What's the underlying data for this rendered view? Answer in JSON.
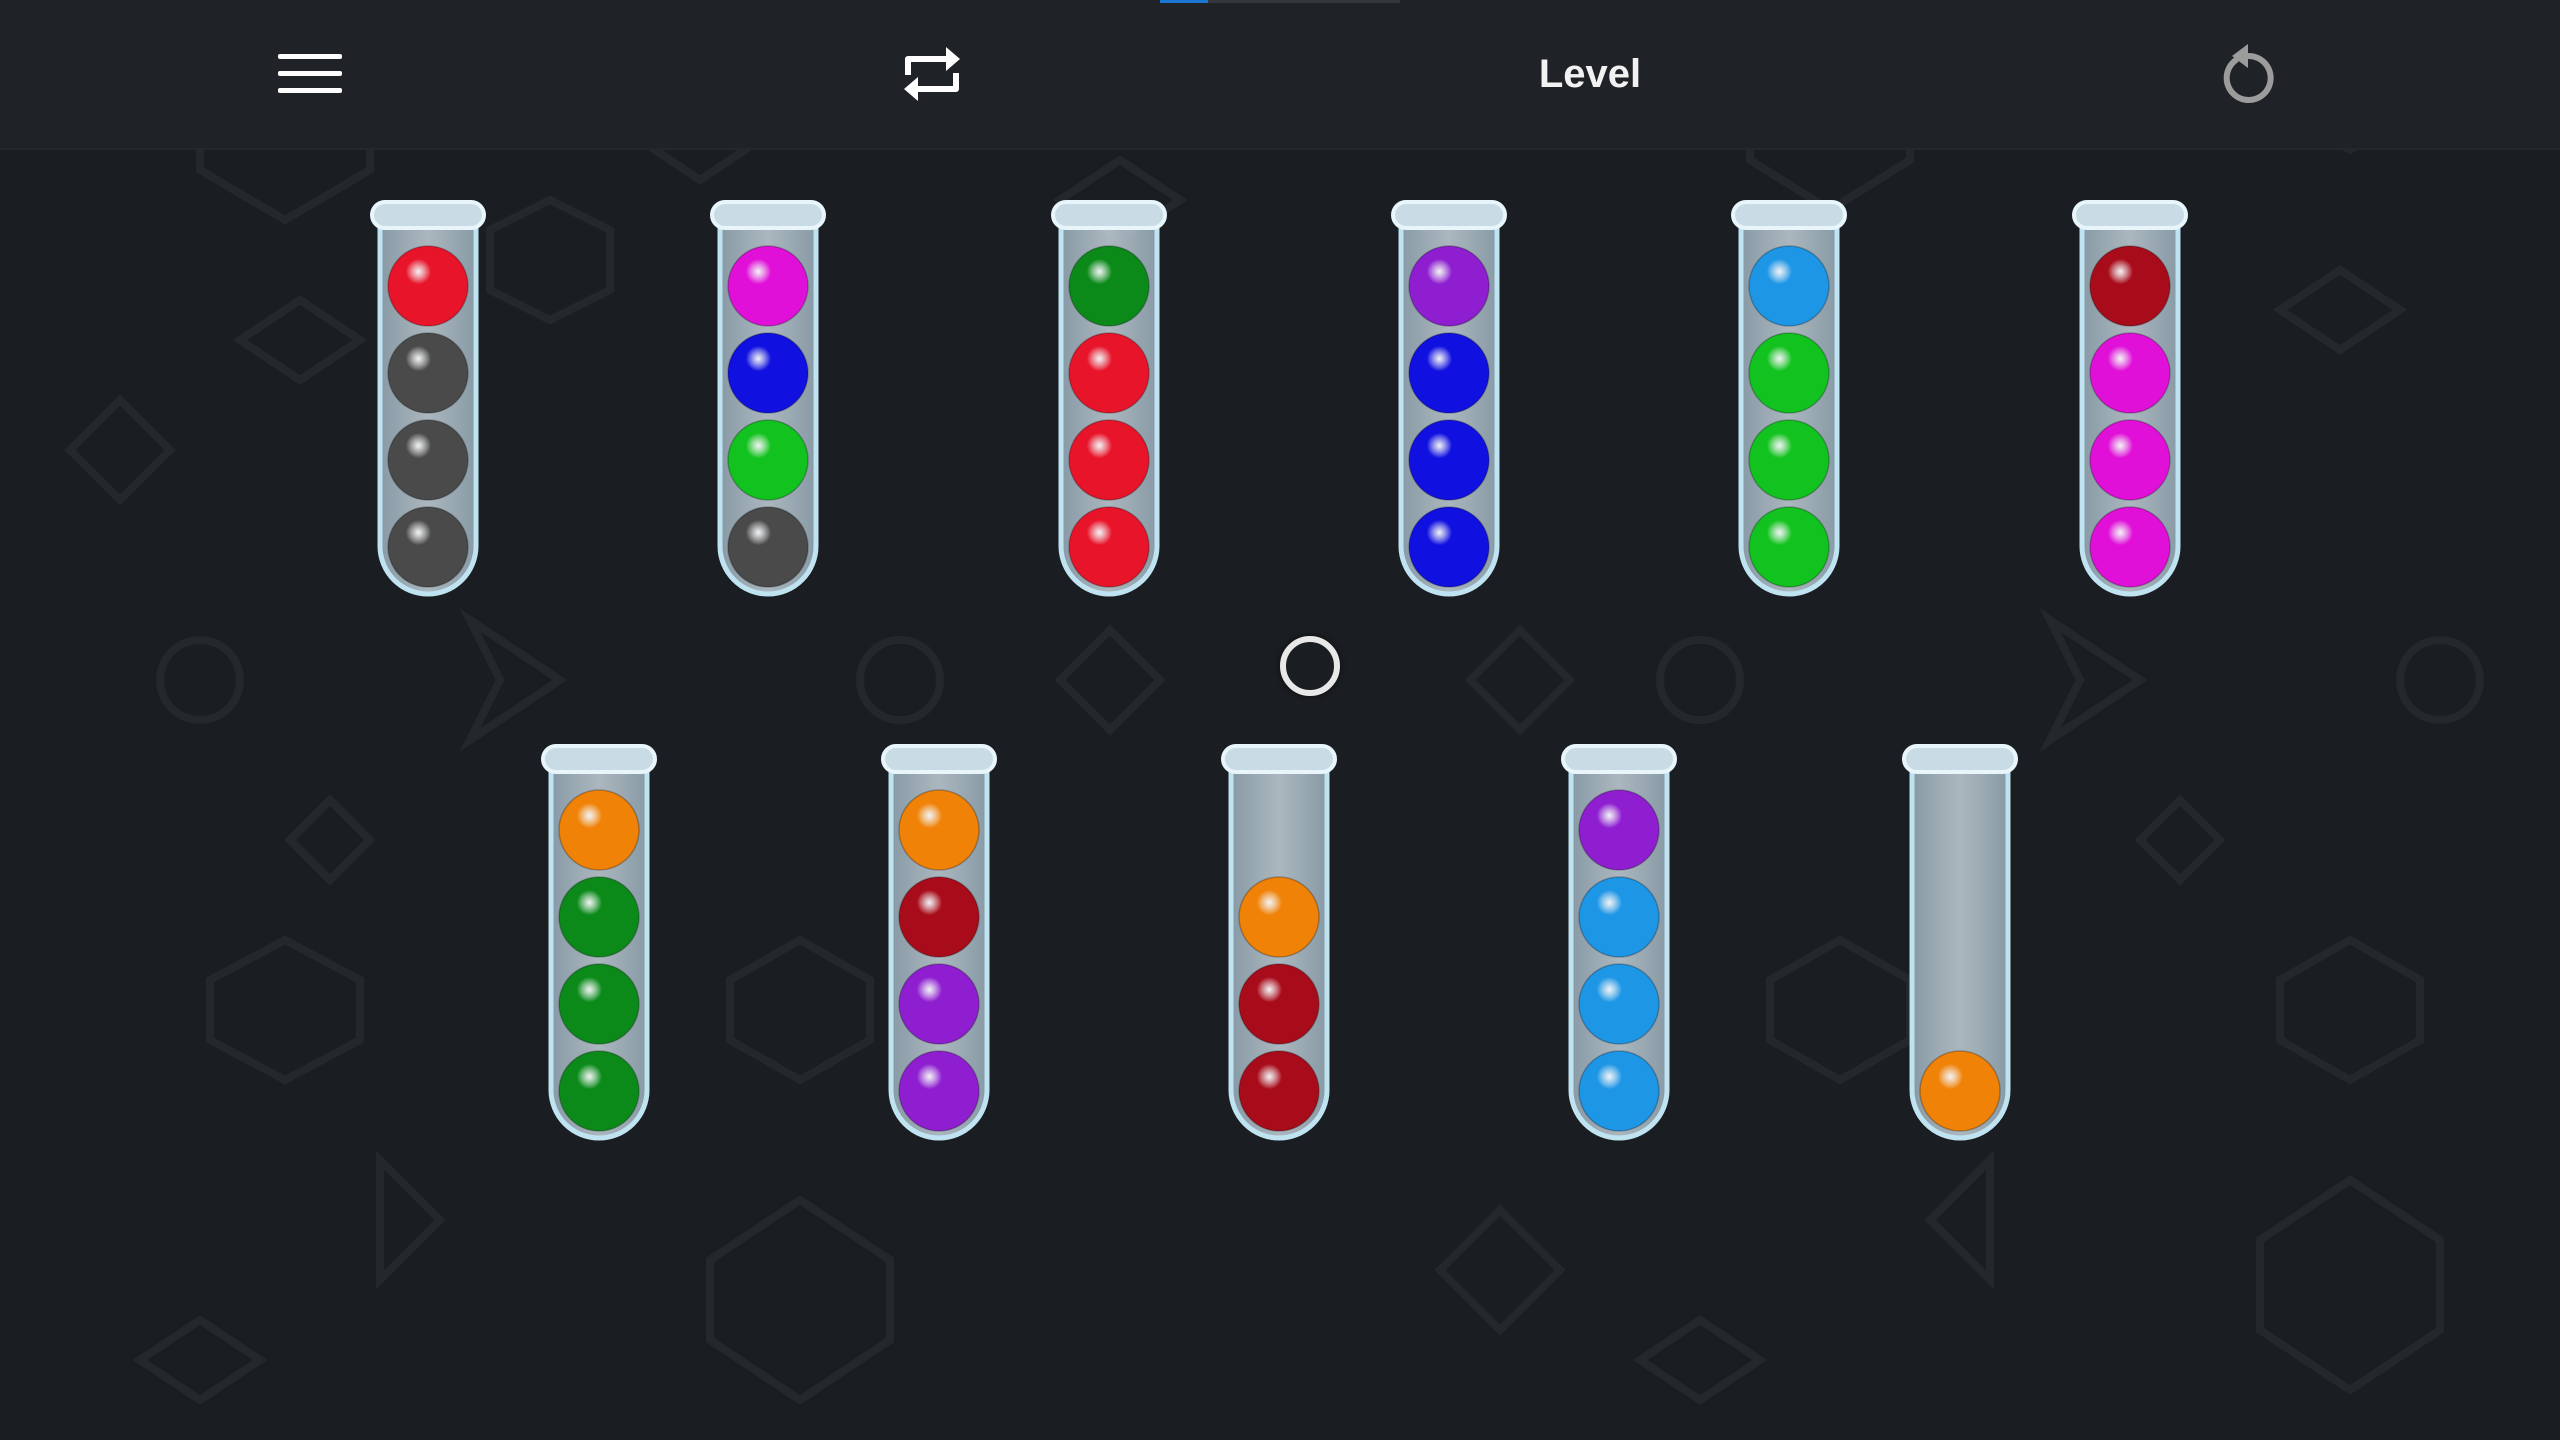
{
  "header": {
    "title": "Level",
    "menu_icon": "hamburger-menu-icon",
    "shuffle_icon": "shuffle-arrows-icon",
    "restart_icon": "restart-icon",
    "progress_fraction": 0.2,
    "progress_color": "#1976d2"
  },
  "colors": {
    "red": "#e8142a",
    "gray": "#4a4a4a",
    "magenta": "#e010d8",
    "blue": "#1010e0",
    "green": "#12c21e",
    "darkgreen": "#0b8a1a",
    "purple": "#8e1ed0",
    "skyblue": "#1e96e6",
    "darkred": "#a80c1a",
    "orange": "#f08208"
  },
  "tubes": [
    {
      "balls": [
        "red",
        "gray",
        "gray",
        "gray"
      ]
    },
    {
      "balls": [
        "magenta",
        "blue",
        "green",
        "gray"
      ]
    },
    {
      "balls": [
        "darkgreen",
        "red",
        "red",
        "red"
      ]
    },
    {
      "balls": [
        "purple",
        "blue",
        "blue",
        "blue"
      ]
    },
    {
      "balls": [
        "skyblue",
        "green",
        "green",
        "green"
      ]
    },
    {
      "balls": [
        "darkred",
        "magenta",
        "magenta",
        "magenta"
      ]
    },
    {
      "balls": [
        "orange",
        "darkgreen",
        "darkgreen",
        "darkgreen"
      ]
    },
    {
      "balls": [
        "orange",
        "darkred",
        "purple",
        "purple"
      ]
    },
    {
      "balls": [
        "orange",
        "darkred",
        "darkred"
      ]
    },
    {
      "balls": [
        "purple",
        "skyblue",
        "skyblue",
        "skyblue"
      ]
    },
    {
      "balls": [
        "orange"
      ]
    }
  ]
}
